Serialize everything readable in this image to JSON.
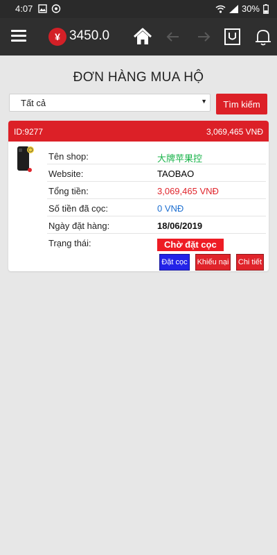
{
  "status_bar": {
    "time": "4:07",
    "battery": "30%"
  },
  "app_bar": {
    "currency_symbol": "¥",
    "balance": "3450.0"
  },
  "page": {
    "title": "ĐƠN HÀNG MUA HỘ"
  },
  "filter": {
    "selected": "Tất cả",
    "search_label": "Tìm kiếm"
  },
  "order": {
    "id": "ID:9277",
    "header_total": "3,069,465 VNĐ",
    "fields": {
      "shop_label": "Tên shop:",
      "shop_value": "大牌苹果控",
      "website_label": "Website:",
      "website_value": "TAOBAO",
      "total_label": "Tổng tiền:",
      "total_value": "3,069,465 VNĐ",
      "deposit_label": "Số tiền đã cọc:",
      "deposit_value": "0 VNĐ",
      "date_label": "Ngày đặt hàng:",
      "date_value": "18/06/2019",
      "status_label": "Trạng thái:",
      "status_value": "Chờ đặt cọc"
    },
    "actions": {
      "deposit": "Đặt cọc",
      "complain": "Khiếu nại",
      "detail": "Chi tiết"
    }
  },
  "colors": {
    "accent_red": "#dc2027",
    "shop_green": "#19b34a",
    "deposit_blue": "#1d6fd1",
    "deposit_button_blue": "#2323e8",
    "appbar_dark": "#2f2f2f"
  },
  "icons": [
    "menu-icon",
    "yen-icon",
    "home-icon",
    "back-arrow-icon",
    "forward-arrow-icon",
    "shopping-bag-icon",
    "bell-icon",
    "wifi-icon",
    "signal-icon",
    "battery-icon",
    "image-icon",
    "eye-icon"
  ]
}
